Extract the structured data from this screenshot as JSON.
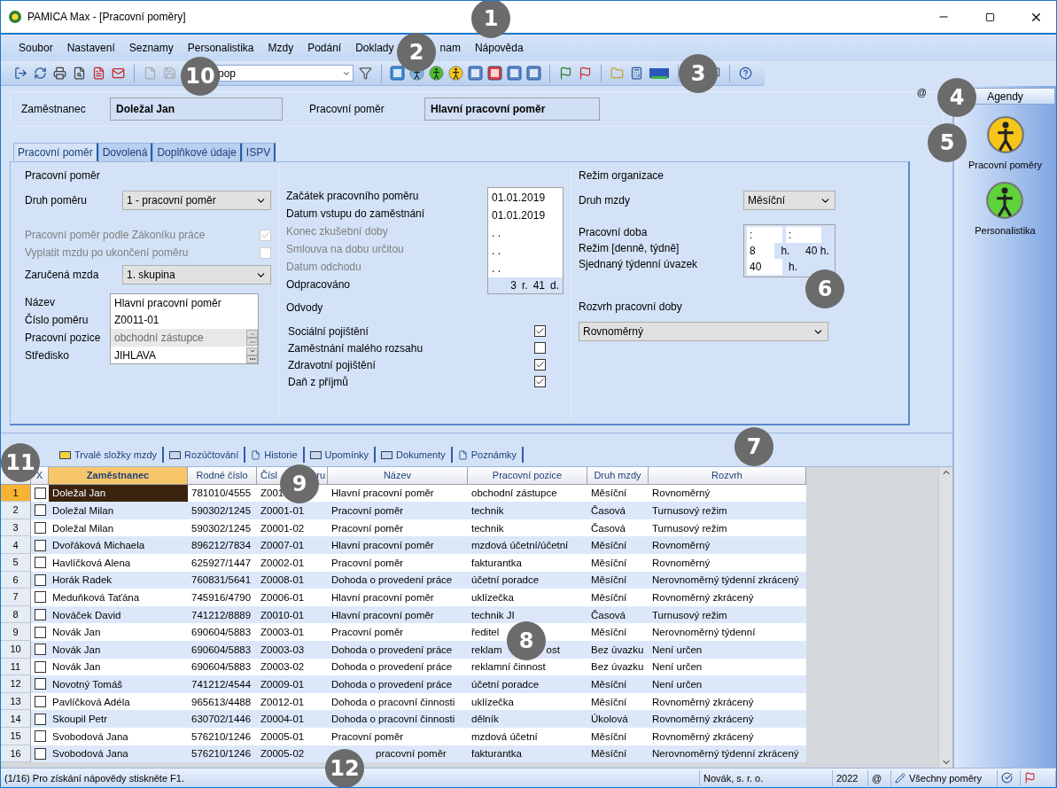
{
  "window": {
    "title": "PAMICA Max - [Pracovní poměry]"
  },
  "menu": [
    "Soubor",
    "Nastavení",
    "Seznamy",
    "Personalistika",
    "Mzdy",
    "Podání",
    "Doklady",
    {
      "after": "nam"
    },
    "Nápověda"
  ],
  "toolbar": {
    "search_value": "pop"
  },
  "header": {
    "employee_label": "Zaměstnanec",
    "employee": "Doležal Jan",
    "relation_label": "Pracovní poměr",
    "relation": "Hlavní pracovní poměr",
    "mark": "@"
  },
  "form_tabs": [
    {
      "label": "Pracovní poměr",
      "selected": true
    },
    {
      "label": "Dovolená",
      "selected": false
    },
    {
      "label": "Doplňkové údaje",
      "selected": false
    },
    {
      "label": "ISPV",
      "selected": false
    }
  ],
  "left": {
    "legend": "Pracovní poměr",
    "kind_label": "Druh poměru",
    "kind_value": "1 - pracovní poměr",
    "flags": [
      {
        "label": "Pracovní poměr podle Zákoníku práce",
        "checked": true,
        "disabled": true
      },
      {
        "label": "Vyplatit mzdu po ukončení poměru",
        "checked": false,
        "disabled": true
      }
    ],
    "wage_label": "Zaručená mzda",
    "wage_value": "1. skupina",
    "details": [
      {
        "label": "Název",
        "value": "Hlavní pracovní poměr",
        "kind": "text",
        "disabled": false
      },
      {
        "label": "Číslo poměru",
        "value": "Z0011-01",
        "kind": "text",
        "disabled": false
      },
      {
        "label": "Pracovní pozice",
        "value": "obchodní zástupce",
        "kind": "lookup",
        "disabled": true
      },
      {
        "label": "Středisko",
        "value": "JIHLAVA",
        "kind": "lookup",
        "disabled": false
      }
    ]
  },
  "middle": {
    "dates": [
      {
        "label": "Začátek pracovního poměru",
        "value": "01.01.2019",
        "disabled": false
      },
      {
        "label": "Datum vstupu do zaměstnání",
        "value": "01.01.2019",
        "disabled": false
      },
      {
        "label": "Konec zkušební doby",
        "value": ". .",
        "disabled": true
      },
      {
        "label": "Smlouva na dobu určitou",
        "value": ". .",
        "disabled": true
      },
      {
        "label": "Datum odchodu",
        "value": ". .",
        "disabled": true
      }
    ],
    "worked_label": "Odpracováno",
    "worked": [
      "3",
      "r.",
      "41",
      "d."
    ],
    "levies_legend": "Odvody",
    "levies": [
      {
        "label": "Sociální pojištění",
        "checked": true
      },
      {
        "label": "Zaměstnání malého rozsahu",
        "checked": false
      },
      {
        "label": "Zdravotní pojištění",
        "checked": true
      },
      {
        "label": "Daň z příjmů",
        "checked": true
      }
    ]
  },
  "right": {
    "legend": "Režim organizace",
    "wage_kind_label": "Druh mzdy",
    "wage_kind_value": "Měsíční",
    "hours_labels": [
      "Pracovní doba",
      "Režim [denně, týdně]",
      "Sjednaný týdenní úvazek"
    ],
    "hours": [
      [
        ":",
        ":"
      ],
      [
        "8",
        "h.",
        "40 h."
      ],
      [
        "40",
        "h."
      ]
    ],
    "schedule_legend": "Rozvrh pracovní doby",
    "schedule_value": "Rovnoměrný"
  },
  "agenda": {
    "button": "Agendy",
    "items": [
      {
        "label": "Pracovní poměry",
        "kind": "relations"
      },
      {
        "label": "Personalistika",
        "kind": "personnel"
      }
    ]
  },
  "grid_tabs": [
    "Trvalé složky mzdy",
    "Rozúčtování",
    "Historie",
    "Upomínky",
    "Dokumenty",
    "Poznámky"
  ],
  "table": {
    "check_column": "X",
    "columns": [
      "Zaměstnanec",
      "Rodné číslo",
      {
        "before": "Čísl",
        "after": "ru"
      },
      "Název",
      "Pracovní pozice",
      "Druh mzdy",
      "Rozvrh"
    ],
    "rows": [
      {
        "n": "1",
        "checked": false,
        "selected": true,
        "cells": [
          "Doležal Jan",
          "781010/4555",
          "Z001",
          "Hlavní pracovní poměr",
          "obchodní zástupce",
          "Měsíční",
          "Rovnoměrný"
        ]
      },
      {
        "n": "2",
        "checked": false,
        "selected": false,
        "cells": [
          "Doležal Milan",
          "590302/1245",
          "Z0001-01",
          "Pracovní poměr",
          "technik",
          "Časová",
          "Turnusový režim"
        ]
      },
      {
        "n": "3",
        "checked": false,
        "selected": false,
        "cells": [
          "Doležal Milan",
          "590302/1245",
          "Z0001-02",
          "Pracovní poměr",
          "technik",
          "Časová",
          "Turnusový režim"
        ]
      },
      {
        "n": "4",
        "checked": false,
        "selected": false,
        "cells": [
          "Dvořáková Michaela",
          "896212/7834",
          "Z0007-01",
          "Hlavní pracovní poměr",
          "mzdová účetní/účetní",
          "Měsíční",
          "Rovnoměrný"
        ]
      },
      {
        "n": "5",
        "checked": false,
        "selected": false,
        "cells": [
          "Havlíčková Alena",
          "625927/1447",
          "Z0002-01",
          "Pracovní poměr",
          "fakturantka",
          "Měsíční",
          "Rovnoměrný"
        ]
      },
      {
        "n": "6",
        "checked": false,
        "selected": false,
        "cells": [
          "Horák Radek",
          "760831/5641",
          "Z0008-01",
          "Dohoda o provedení práce",
          "účetní poradce",
          "Měsíční",
          "Nerovnoměrný týdenní zkrácený"
        ]
      },
      {
        "n": "7",
        "checked": false,
        "selected": false,
        "cells": [
          "Meduňková Taťána",
          "745916/4790",
          "Z0006-01",
          "Hlavní pracovní poměr",
          "uklízečka",
          "Měsíční",
          "Rovnoměrný zkrácený"
        ]
      },
      {
        "n": "8",
        "checked": false,
        "selected": false,
        "cells": [
          "Nováček David",
          "741212/8889",
          "Z0010-01",
          "Hlavní pracovní poměr",
          "technik JI",
          "Časová",
          "Turnusový režim"
        ]
      },
      {
        "n": "9",
        "checked": false,
        "selected": false,
        "cells": [
          "Novák Jan",
          "690604/5883",
          "Z0003-01",
          "Pracovní poměr",
          "ředitel",
          "Měsíční",
          "Nerovnoměrný týdenní"
        ]
      },
      {
        "n": "10",
        "checked": false,
        "selected": false,
        "cells": [
          "Novák Jan",
          "690604/5883",
          "Z0003-03",
          "Dohoda o provedení práce",
          {
            "before": "reklam",
            "after": "ost"
          },
          "Bez úvazku",
          "Není určen"
        ]
      },
      {
        "n": "11",
        "checked": false,
        "selected": false,
        "cells": [
          "Novák Jan",
          "690604/5883",
          "Z0003-02",
          "Dohoda o provedení práce",
          "reklamní činnost",
          "Bez úvazku",
          "Není určen"
        ]
      },
      {
        "n": "12",
        "checked": false,
        "selected": false,
        "cells": [
          "Novotný Tomáš",
          "741212/4544",
          "Z0009-01",
          "Dohoda o provedení práce",
          "účetní poradce",
          "Měsíční",
          "Není určen"
        ]
      },
      {
        "n": "13",
        "checked": false,
        "selected": false,
        "cells": [
          "Pavlíčková Adéla",
          "965613/4488",
          "Z0012-01",
          "Dohoda o pracovní činnosti",
          "uklízečka",
          "Měsíční",
          "Rovnoměrný zkrácený"
        ]
      },
      {
        "n": "14",
        "checked": false,
        "selected": false,
        "cells": [
          "Skoupil Petr",
          "630702/1446",
          "Z0004-01",
          "Dohoda o pracovní činnosti",
          "dělník",
          "Úkolová",
          "Rovnoměrný zkrácený"
        ]
      },
      {
        "n": "15",
        "checked": false,
        "selected": false,
        "cells": [
          "Svobodová Jana",
          "576210/1246",
          "Z0005-01",
          "Pracovní poměr",
          "mzdová účetní",
          "Měsíční",
          "Rovnoměrný zkrácený"
        ]
      },
      {
        "n": "16",
        "checked": false,
        "selected": false,
        "cells": [
          "Svobodová Jana",
          "576210/1246",
          "Z0005-02",
          {
            "after": "pracovní poměr"
          },
          "fakturantka",
          "Měsíční",
          "Nerovnoměrný týdenní zkrácený"
        ]
      }
    ]
  },
  "status_bar": {
    "hint": "(1/16) Pro získání nápovědy stiskněte F1.",
    "company": "Novák, s. r. o.",
    "year": "2022",
    "mark": "@",
    "filter": "Všechny poměry"
  },
  "callouts": [
    "1",
    "2",
    "3",
    "4",
    "5",
    "6",
    "7",
    "8",
    "9",
    "10",
    "11",
    "12"
  ]
}
